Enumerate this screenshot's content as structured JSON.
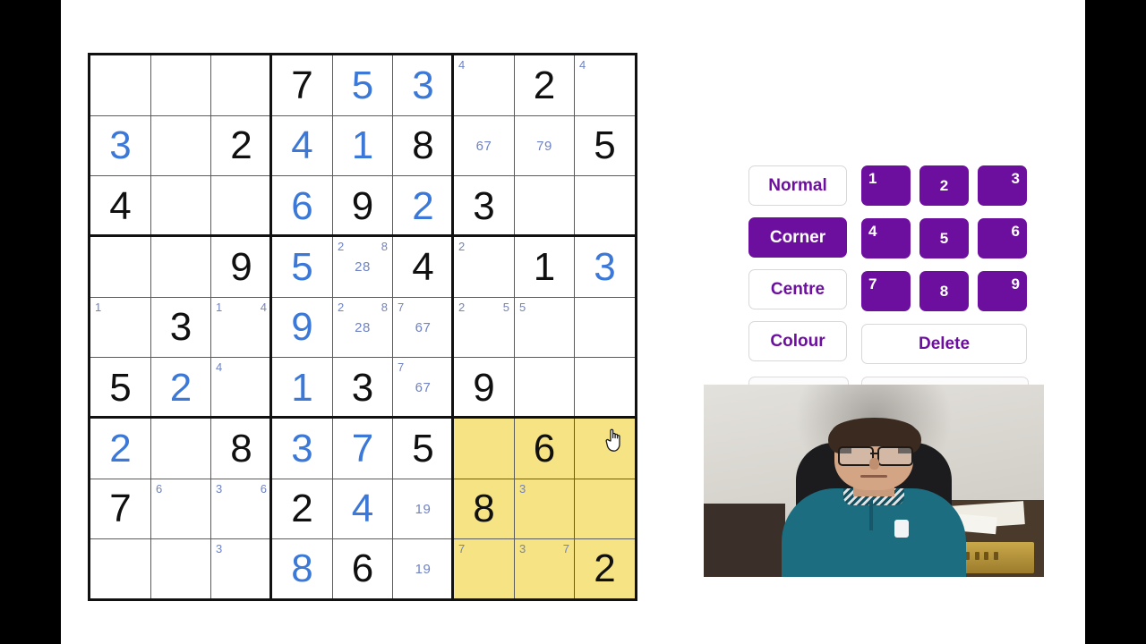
{
  "app": {
    "title": "Sudoku Solver",
    "grid_size": 9
  },
  "grid": {
    "cells": [
      {
        "r": 1,
        "c": 1,
        "value": "",
        "style": "",
        "corner": [],
        "centre": "",
        "highlight": false
      },
      {
        "r": 1,
        "c": 2,
        "value": "",
        "style": "",
        "corner": [],
        "centre": "",
        "highlight": false
      },
      {
        "r": 1,
        "c": 3,
        "value": "",
        "style": "",
        "corner": [],
        "centre": "",
        "highlight": false
      },
      {
        "r": 1,
        "c": 4,
        "value": "7",
        "style": "given",
        "corner": [],
        "centre": "",
        "highlight": false
      },
      {
        "r": 1,
        "c": 5,
        "value": "5",
        "style": "user",
        "corner": [],
        "centre": "",
        "highlight": false
      },
      {
        "r": 1,
        "c": 6,
        "value": "3",
        "style": "user",
        "corner": [],
        "centre": "",
        "highlight": false
      },
      {
        "r": 1,
        "c": 7,
        "value": "",
        "style": "",
        "corner": [
          "4"
        ],
        "centre": "",
        "highlight": false
      },
      {
        "r": 1,
        "c": 8,
        "value": "2",
        "style": "given",
        "corner": [],
        "centre": "",
        "highlight": false
      },
      {
        "r": 1,
        "c": 9,
        "value": "",
        "style": "",
        "corner": [
          "4"
        ],
        "centre": "",
        "highlight": false
      },
      {
        "r": 2,
        "c": 1,
        "value": "3",
        "style": "user",
        "corner": [],
        "centre": "",
        "highlight": false
      },
      {
        "r": 2,
        "c": 2,
        "value": "",
        "style": "",
        "corner": [],
        "centre": "",
        "highlight": false
      },
      {
        "r": 2,
        "c": 3,
        "value": "2",
        "style": "given",
        "corner": [],
        "centre": "",
        "highlight": false
      },
      {
        "r": 2,
        "c": 4,
        "value": "4",
        "style": "user",
        "corner": [],
        "centre": "",
        "highlight": false
      },
      {
        "r": 2,
        "c": 5,
        "value": "1",
        "style": "user",
        "corner": [],
        "centre": "",
        "highlight": false
      },
      {
        "r": 2,
        "c": 6,
        "value": "8",
        "style": "given",
        "corner": [],
        "centre": "",
        "highlight": false
      },
      {
        "r": 2,
        "c": 7,
        "value": "",
        "style": "",
        "corner": [],
        "centre": "67",
        "highlight": false
      },
      {
        "r": 2,
        "c": 8,
        "value": "",
        "style": "",
        "corner": [],
        "centre": "79",
        "highlight": false
      },
      {
        "r": 2,
        "c": 9,
        "value": "5",
        "style": "given",
        "corner": [],
        "centre": "",
        "highlight": false
      },
      {
        "r": 3,
        "c": 1,
        "value": "4",
        "style": "given",
        "corner": [],
        "centre": "",
        "highlight": false
      },
      {
        "r": 3,
        "c": 2,
        "value": "",
        "style": "",
        "corner": [],
        "centre": "",
        "highlight": false
      },
      {
        "r": 3,
        "c": 3,
        "value": "",
        "style": "",
        "corner": [],
        "centre": "",
        "highlight": false
      },
      {
        "r": 3,
        "c": 4,
        "value": "6",
        "style": "user",
        "corner": [],
        "centre": "",
        "highlight": false
      },
      {
        "r": 3,
        "c": 5,
        "value": "9",
        "style": "given",
        "corner": [],
        "centre": "",
        "highlight": false
      },
      {
        "r": 3,
        "c": 6,
        "value": "2",
        "style": "user",
        "corner": [],
        "centre": "",
        "highlight": false
      },
      {
        "r": 3,
        "c": 7,
        "value": "3",
        "style": "given",
        "corner": [],
        "centre": "",
        "highlight": false
      },
      {
        "r": 3,
        "c": 8,
        "value": "",
        "style": "",
        "corner": [],
        "centre": "",
        "highlight": false
      },
      {
        "r": 3,
        "c": 9,
        "value": "",
        "style": "",
        "corner": [],
        "centre": "",
        "highlight": false
      },
      {
        "r": 4,
        "c": 1,
        "value": "",
        "style": "",
        "corner": [],
        "centre": "",
        "highlight": false
      },
      {
        "r": 4,
        "c": 2,
        "value": "",
        "style": "",
        "corner": [],
        "centre": "",
        "highlight": false
      },
      {
        "r": 4,
        "c": 3,
        "value": "9",
        "style": "given",
        "corner": [],
        "centre": "",
        "highlight": false
      },
      {
        "r": 4,
        "c": 4,
        "value": "5",
        "style": "user",
        "corner": [],
        "centre": "",
        "highlight": false
      },
      {
        "r": 4,
        "c": 5,
        "value": "",
        "style": "",
        "corner": [
          "2",
          "8"
        ],
        "centre": "28",
        "highlight": false
      },
      {
        "r": 4,
        "c": 6,
        "value": "4",
        "style": "given",
        "corner": [],
        "centre": "",
        "highlight": false
      },
      {
        "r": 4,
        "c": 7,
        "value": "",
        "style": "",
        "corner": [
          "2"
        ],
        "centre": "",
        "highlight": false
      },
      {
        "r": 4,
        "c": 8,
        "value": "1",
        "style": "given",
        "corner": [],
        "centre": "",
        "highlight": false
      },
      {
        "r": 4,
        "c": 9,
        "value": "3",
        "style": "user",
        "corner": [],
        "centre": "",
        "highlight": false
      },
      {
        "r": 5,
        "c": 1,
        "value": "",
        "style": "",
        "corner": [
          "1"
        ],
        "centre": "",
        "highlight": false
      },
      {
        "r": 5,
        "c": 2,
        "value": "3",
        "style": "given",
        "corner": [],
        "centre": "",
        "highlight": false
      },
      {
        "r": 5,
        "c": 3,
        "value": "",
        "style": "",
        "corner": [
          "1",
          "4"
        ],
        "centre": "",
        "highlight": false
      },
      {
        "r": 5,
        "c": 4,
        "value": "9",
        "style": "user",
        "corner": [],
        "centre": "",
        "highlight": false
      },
      {
        "r": 5,
        "c": 5,
        "value": "",
        "style": "",
        "corner": [
          "2",
          "8"
        ],
        "centre": "28",
        "highlight": false
      },
      {
        "r": 5,
        "c": 6,
        "value": "",
        "style": "",
        "corner": [
          "7"
        ],
        "centre": "67",
        "highlight": false
      },
      {
        "r": 5,
        "c": 7,
        "value": "",
        "style": "",
        "corner": [
          "2",
          "5"
        ],
        "centre": "",
        "highlight": false
      },
      {
        "r": 5,
        "c": 8,
        "value": "",
        "style": "",
        "corner": [
          "5"
        ],
        "centre": "",
        "highlight": false
      },
      {
        "r": 5,
        "c": 9,
        "value": "",
        "style": "",
        "corner": [],
        "centre": "",
        "highlight": false
      },
      {
        "r": 6,
        "c": 1,
        "value": "5",
        "style": "given",
        "corner": [],
        "centre": "",
        "highlight": false
      },
      {
        "r": 6,
        "c": 2,
        "value": "2",
        "style": "user",
        "corner": [],
        "centre": "",
        "highlight": false
      },
      {
        "r": 6,
        "c": 3,
        "value": "",
        "style": "",
        "corner": [
          "4"
        ],
        "centre": "",
        "highlight": false
      },
      {
        "r": 6,
        "c": 4,
        "value": "1",
        "style": "user",
        "corner": [],
        "centre": "",
        "highlight": false
      },
      {
        "r": 6,
        "c": 5,
        "value": "3",
        "style": "given",
        "corner": [],
        "centre": "",
        "highlight": false
      },
      {
        "r": 6,
        "c": 6,
        "value": "",
        "style": "",
        "corner": [
          "7"
        ],
        "centre": "67",
        "highlight": false
      },
      {
        "r": 6,
        "c": 7,
        "value": "9",
        "style": "given",
        "corner": [],
        "centre": "",
        "highlight": false
      },
      {
        "r": 6,
        "c": 8,
        "value": "",
        "style": "",
        "corner": [],
        "centre": "",
        "highlight": false
      },
      {
        "r": 6,
        "c": 9,
        "value": "",
        "style": "",
        "corner": [],
        "centre": "",
        "highlight": false
      },
      {
        "r": 7,
        "c": 1,
        "value": "2",
        "style": "user",
        "corner": [],
        "centre": "",
        "highlight": false
      },
      {
        "r": 7,
        "c": 2,
        "value": "",
        "style": "",
        "corner": [],
        "centre": "",
        "highlight": false
      },
      {
        "r": 7,
        "c": 3,
        "value": "8",
        "style": "given",
        "corner": [],
        "centre": "",
        "highlight": false
      },
      {
        "r": 7,
        "c": 4,
        "value": "3",
        "style": "user",
        "corner": [],
        "centre": "",
        "highlight": false
      },
      {
        "r": 7,
        "c": 5,
        "value": "7",
        "style": "user",
        "corner": [],
        "centre": "",
        "highlight": false
      },
      {
        "r": 7,
        "c": 6,
        "value": "5",
        "style": "given",
        "corner": [],
        "centre": "",
        "highlight": false
      },
      {
        "r": 7,
        "c": 7,
        "value": "",
        "style": "",
        "corner": [],
        "centre": "",
        "highlight": true
      },
      {
        "r": 7,
        "c": 8,
        "value": "6",
        "style": "given",
        "corner": [],
        "centre": "",
        "highlight": true
      },
      {
        "r": 7,
        "c": 9,
        "value": "",
        "style": "",
        "corner": [],
        "centre": "",
        "highlight": true
      },
      {
        "r": 8,
        "c": 1,
        "value": "7",
        "style": "given",
        "corner": [],
        "centre": "",
        "highlight": false
      },
      {
        "r": 8,
        "c": 2,
        "value": "",
        "style": "",
        "corner": [
          "6"
        ],
        "centre": "",
        "highlight": false
      },
      {
        "r": 8,
        "c": 3,
        "value": "",
        "style": "",
        "corner": [
          "3",
          "6"
        ],
        "centre": "",
        "highlight": false
      },
      {
        "r": 8,
        "c": 4,
        "value": "2",
        "style": "given",
        "corner": [],
        "centre": "",
        "highlight": false
      },
      {
        "r": 8,
        "c": 5,
        "value": "4",
        "style": "user",
        "corner": [],
        "centre": "",
        "highlight": false
      },
      {
        "r": 8,
        "c": 6,
        "value": "",
        "style": "",
        "corner": [],
        "centre": "19",
        "highlight": false
      },
      {
        "r": 8,
        "c": 7,
        "value": "8",
        "style": "given",
        "corner": [],
        "centre": "",
        "highlight": true
      },
      {
        "r": 8,
        "c": 8,
        "value": "",
        "style": "",
        "corner": [
          "3"
        ],
        "centre": "",
        "highlight": true
      },
      {
        "r": 8,
        "c": 9,
        "value": "",
        "style": "",
        "corner": [],
        "centre": "",
        "highlight": true
      },
      {
        "r": 9,
        "c": 1,
        "value": "",
        "style": "",
        "corner": [],
        "centre": "",
        "highlight": false
      },
      {
        "r": 9,
        "c": 2,
        "value": "",
        "style": "",
        "corner": [],
        "centre": "",
        "highlight": false
      },
      {
        "r": 9,
        "c": 3,
        "value": "",
        "style": "",
        "corner": [
          "3"
        ],
        "centre": "",
        "highlight": false
      },
      {
        "r": 9,
        "c": 4,
        "value": "8",
        "style": "user",
        "corner": [],
        "centre": "",
        "highlight": false
      },
      {
        "r": 9,
        "c": 5,
        "value": "6",
        "style": "given",
        "corner": [],
        "centre": "",
        "highlight": false
      },
      {
        "r": 9,
        "c": 6,
        "value": "",
        "style": "",
        "corner": [],
        "centre": "19",
        "highlight": false
      },
      {
        "r": 9,
        "c": 7,
        "value": "",
        "style": "",
        "corner": [
          "7"
        ],
        "centre": "",
        "highlight": true
      },
      {
        "r": 9,
        "c": 8,
        "value": "",
        "style": "",
        "corner": [
          "3",
          "7"
        ],
        "centre": "",
        "highlight": true
      },
      {
        "r": 9,
        "c": 9,
        "value": "2",
        "style": "given",
        "corner": [],
        "centre": "",
        "highlight": true
      }
    ]
  },
  "panel": {
    "modes": [
      {
        "label": "Normal",
        "selected": false
      },
      {
        "label": "Corner",
        "selected": true
      },
      {
        "label": "Centre",
        "selected": false
      }
    ],
    "colour_label": "Colour",
    "delete_label": "Delete",
    "numbers": [
      "1",
      "2",
      "3",
      "4",
      "5",
      "6",
      "7",
      "8",
      "9"
    ]
  },
  "cursor": {
    "icon": "pointer-hand-cursor",
    "cell": "r7c9"
  },
  "webcam": {
    "label": "webcam-video"
  },
  "colors": {
    "accent_purple": "#6d0f9e",
    "given_digit": "#101010",
    "user_digit": "#3b78d8",
    "pencil_mark": "#6f83c4",
    "highlight_yellow": "#f5e384"
  }
}
